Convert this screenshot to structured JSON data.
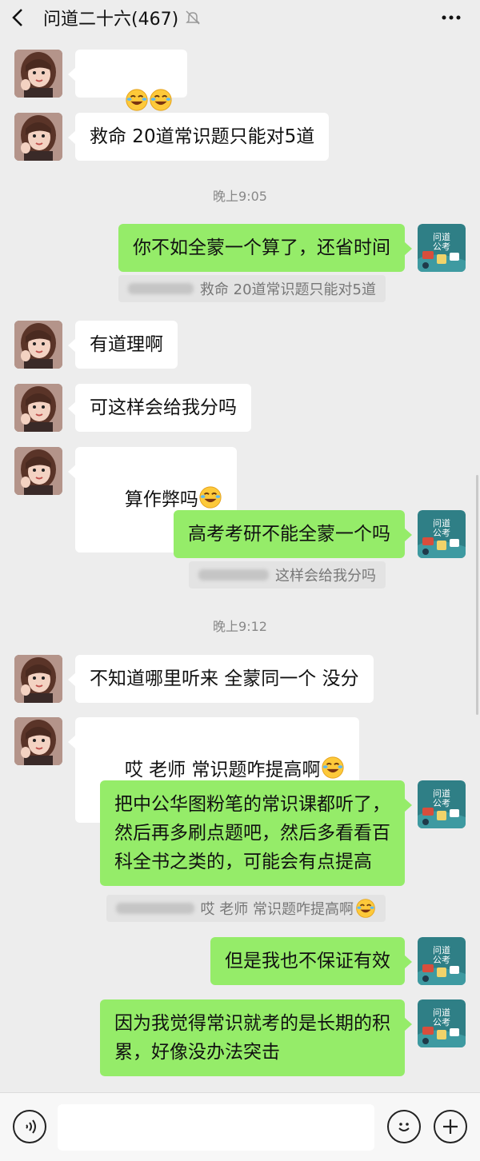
{
  "header": {
    "title": "问道二十六(467)"
  },
  "colors": {
    "background": "#ededed",
    "bubble_out": "#95ec69",
    "bubble_in": "#ffffff",
    "brand_avatar": "#2f7f86"
  },
  "timestamps": {
    "t1": "晚上9:05",
    "t2": "晚上9:12"
  },
  "messages": {
    "m1": "😭😭",
    "m2": "救命 20道常识题只能对5道",
    "m3": "你不如全蒙一个算了，还省时间",
    "m4": "有道理啊",
    "m5": "可这样会给我分吗",
    "m6": "算作弊吗",
    "m7": "高考考研不能全蒙一个吗",
    "m8": "不知道哪里听来 全蒙同一个 没分",
    "m9": "哎 老师 常识题咋提高啊",
    "m10": "把中公华图粉笔的常识课都听了，\n然后再多刷点题吧，然后多看看百\n科全书之类的，可能会有点提高",
    "m11": "但是我也不保证有效",
    "m12": "因为我觉得常识就考的是长期的积\n累，好像没办法突击"
  },
  "quotes": {
    "q1": "救命 20道常识题只能对5道",
    "q2": "这样会给我分吗",
    "q3": "哎 老师 常识题咋提高啊"
  },
  "brand_avatar_text": {
    "line1": "问道",
    "line2": "公考"
  },
  "icons": {
    "back": "chevron-left-icon",
    "mute": "bell-off-icon",
    "more": "more-dots-icon",
    "voice": "voice-icon",
    "emoji": "smiley-icon",
    "plus": "plus-icon",
    "laugh": "laugh-cry-emoji"
  }
}
